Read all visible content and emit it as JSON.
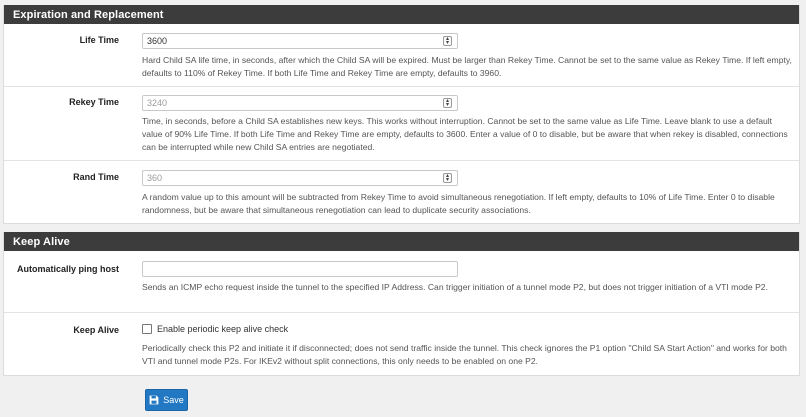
{
  "expiration": {
    "title": "Expiration and Replacement",
    "life_time": {
      "label": "Life Time",
      "value": "3600",
      "help": "Hard Child SA life time, in seconds, after which the Child SA will be expired. Must be larger than Rekey Time. Cannot be set to the same value as Rekey Time. If left empty, defaults to 110% of Rekey Time. If both Life Time and Rekey Time are empty, defaults to 3960."
    },
    "rekey_time": {
      "label": "Rekey Time",
      "placeholder": "3240",
      "help": "Time, in seconds, before a Child SA establishes new keys. This works without interruption. Cannot be set to the same value as Life Time. Leave blank to use a default value of 90% Life Time. If both Life Time and Rekey Time are empty, defaults to 3600. Enter a value of 0 to disable, but be aware that when rekey is disabled, connections can be interrupted while new Child SA entries are negotiated."
    },
    "rand_time": {
      "label": "Rand Time",
      "placeholder": "360",
      "help": "A random value up to this amount will be subtracted from Rekey Time to avoid simultaneous renegotiation. If left empty, defaults to 10% of Life Time. Enter 0 to disable randomness, but be aware that simultaneous renegotiation can lead to duplicate security associations."
    }
  },
  "keep_alive": {
    "title": "Keep Alive",
    "ping_host": {
      "label": "Automatically ping host",
      "value": "",
      "help": "Sends an ICMP echo request inside the tunnel to the specified IP Address. Can trigger initiation of a tunnel mode P2, but does not trigger initiation of a VTI mode P2."
    },
    "keep_alive": {
      "label": "Keep Alive",
      "checkbox_label": "Enable periodic keep alive check",
      "checked": false,
      "help": "Periodically check this P2 and initiate it if disconnected; does not send traffic inside the tunnel. This check ignores the P1 option \"Child SA Start Action\" and works for both VTI and tunnel mode P2s. For IKEv2 without split connections, this only needs to be enabled on one P2."
    }
  },
  "save_label": "Save",
  "icons": {
    "save": "floppy-disk-icon",
    "spinner": "up-down-spinner-icon"
  },
  "colors": {
    "heading_bg": "#3c3c3c",
    "button_bg": "#2378c4"
  }
}
